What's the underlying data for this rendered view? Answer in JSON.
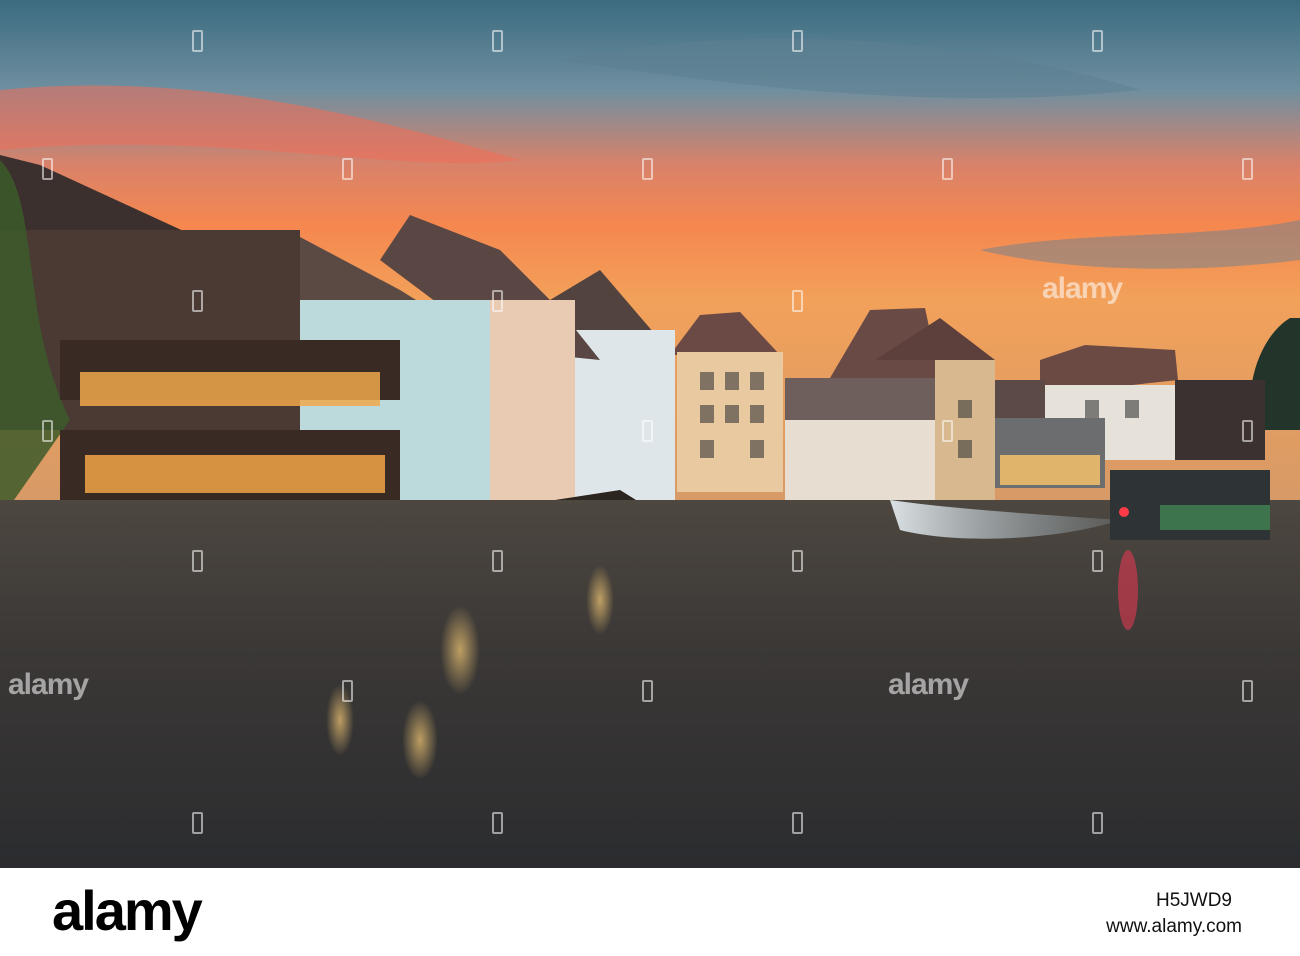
{
  "watermark": {
    "brand": "alamy",
    "small_marks_count_note": ""
  },
  "footer": {
    "logo_text": "alamy",
    "image_id": "H5JWD9",
    "url": "www.alamy.com"
  },
  "colors": {
    "sky_top": "#3e6f86",
    "sky_glow": "#f0774c",
    "water": "#3a3430",
    "window_light": "#f2b24a"
  }
}
